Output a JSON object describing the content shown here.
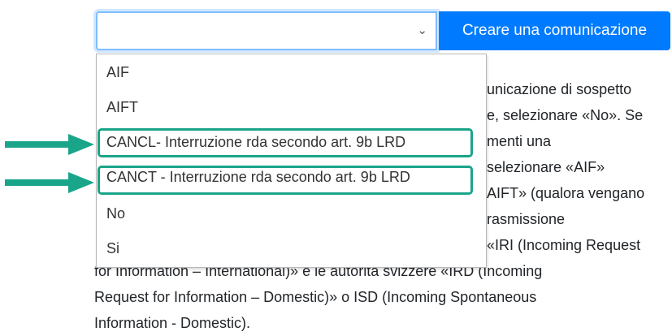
{
  "select": {
    "value": ""
  },
  "button": {
    "label": "Creare una comunicazione"
  },
  "paragraph": {
    "right_lines": [
      "unicazione di sospetto",
      "e, selezionare «No». Se",
      "menti una",
      "selezionare «AIF»",
      "AIFT» (qualora vengano",
      "rasmissione",
      "«IRI (Incoming Request"
    ],
    "tail_lines": [
      "for Information – International)» e le autorità svizzere «IRD (Incoming",
      "Request for Information – Domestic)» o ISD (Incoming Spontaneous",
      "Information - Domestic)."
    ]
  },
  "dropdown": {
    "options": [
      "AIF",
      "AIFT",
      "CANCL- Interruzione rda secondo art. 9b LRD",
      "CANCT - Interruzione rda secondo art. 9b LRD",
      "No",
      "Si"
    ],
    "highlighted_indices": [
      2,
      3
    ]
  },
  "colors": {
    "button_bg": "#007bff",
    "highlight_border": "#19a58a",
    "arrow": "#19a58a"
  },
  "icons": {
    "select_chevron": "chevron-down-icon",
    "pointer": "arrow-right-icon"
  }
}
